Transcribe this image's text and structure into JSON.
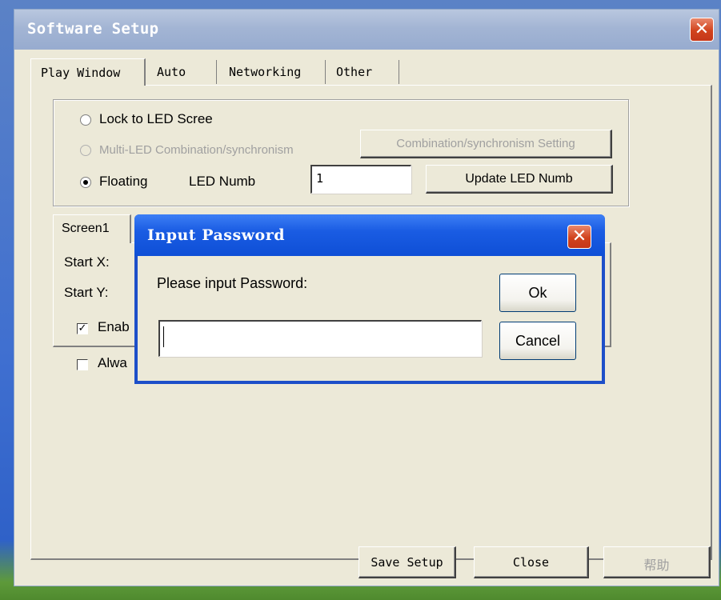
{
  "window": {
    "title": "Software Setup",
    "close_glyph": "✕"
  },
  "tabs": [
    "Play Window",
    "Auto",
    "Networking",
    "Other"
  ],
  "display_mode": {
    "lock_label": "Lock to LED Scree",
    "multi_label": "Multi-LED Combination/synchronism",
    "combination_button": "Combination/synchronism Setting",
    "floating_label": "Floating",
    "led_numb_label": "LED Numb",
    "led_numb_value": "1",
    "update_button": "Update LED Numb",
    "selected": "Floating"
  },
  "screen": {
    "tab_label": "Screen1",
    "start_x_label": "Start X:",
    "start_y_label": "Start Y:",
    "enable_label": "Enab",
    "enable_checked": true,
    "always_label": "Alwa",
    "always_checked": false
  },
  "footer": {
    "save_button": "Save Setup",
    "close_button": "Close",
    "help_button": "帮助"
  },
  "dialog": {
    "title": "Input Password",
    "prompt": "Please input Password:",
    "password_value": "",
    "ok_button": "Ok",
    "cancel_button": "Cancel",
    "close_glyph": "✕"
  },
  "colors": {
    "window_bg": "#ece9d8",
    "inactive_title": "#a3b5d4",
    "active_title": "#1a5ce3",
    "close_red": "#d1431d"
  }
}
